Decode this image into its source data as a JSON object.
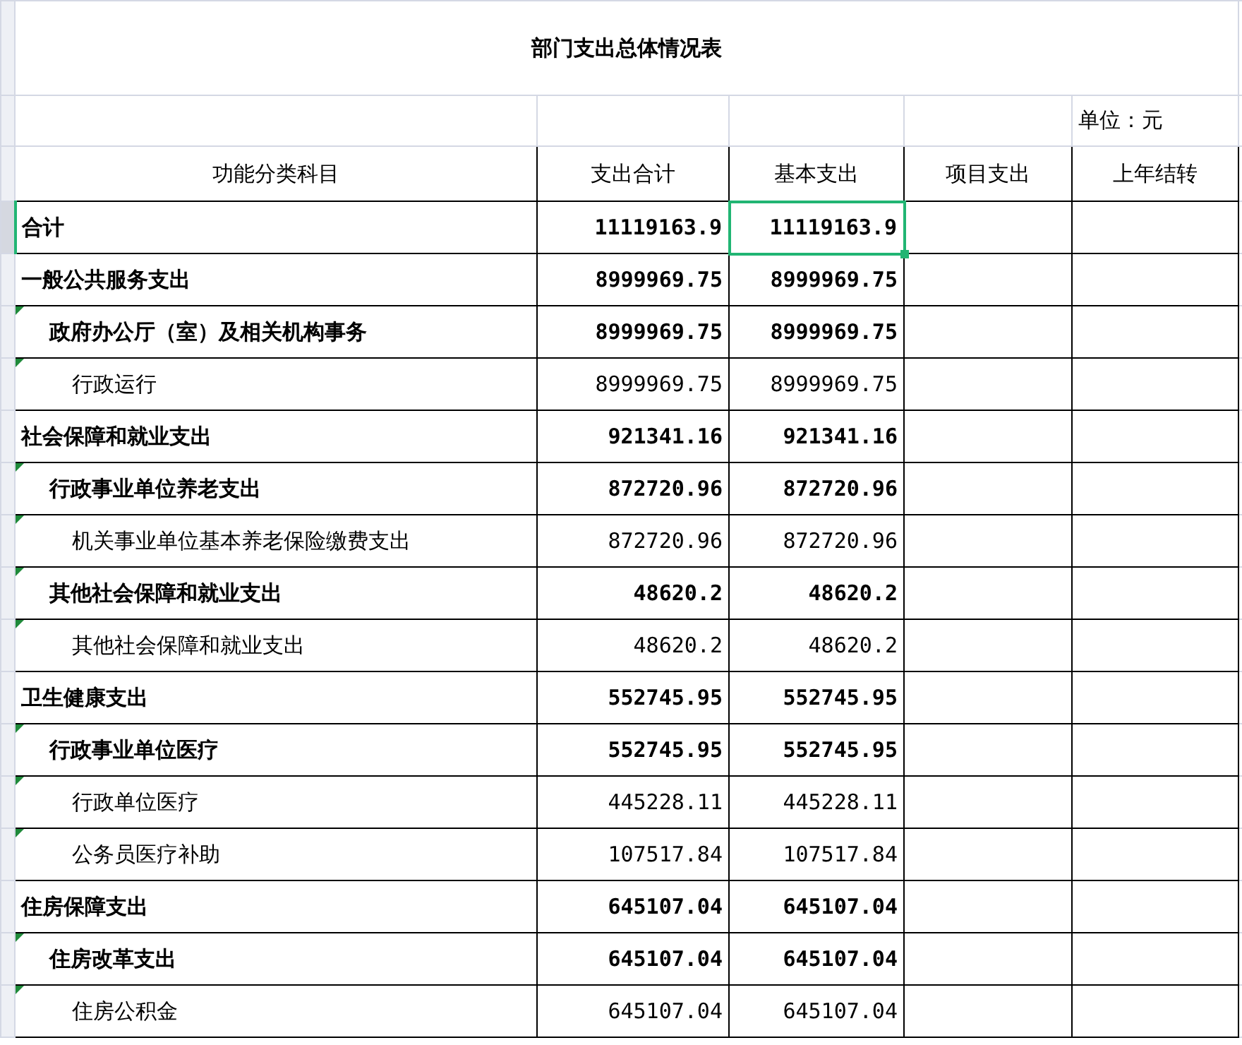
{
  "title": "部门支出总体情况表",
  "unit": "单位：元",
  "columns": [
    "功能分类科目",
    "支出合计",
    "基本支出",
    "项目支出",
    "上年结转"
  ],
  "total": {
    "label": "合计",
    "amounts": [
      {
        "text": "11119163.9",
        "selected": false
      },
      {
        "text": "11119163.9",
        "selected": true
      }
    ]
  },
  "categories": [
    {
      "label": "一般公共服务支出",
      "amounts": [
        {
          "text": "8999969.75",
          "selected": false
        },
        {
          "text": "8999969.75",
          "selected": false
        }
      ],
      "children": [
        {
          "label": "政府办公厅（室）及相关机构事务",
          "amounts": [
            {
              "text": "8999969.75",
              "selected": false
            },
            {
              "text": "8999969.75",
              "selected": false
            }
          ],
          "children": [
            {
              "label": "行政运行",
              "amounts": [
                {
                  "text": "8999969.75",
                  "selected": false
                },
                {
                  "text": "8999969.75",
                  "selected": false
                }
              ]
            }
          ]
        }
      ]
    },
    {
      "label": "社会保障和就业支出",
      "amounts": [
        {
          "text": "921341.16",
          "selected": false
        },
        {
          "text": "921341.16",
          "selected": false
        }
      ],
      "children": [
        {
          "label": "行政事业单位养老支出",
          "amounts": [
            {
              "text": "872720.96",
              "selected": false
            },
            {
              "text": "872720.96",
              "selected": false
            }
          ],
          "children": [
            {
              "label": "机关事业单位基本养老保险缴费支出",
              "amounts": [
                {
                  "text": "872720.96",
                  "selected": false
                },
                {
                  "text": "872720.96",
                  "selected": false
                }
              ]
            }
          ]
        },
        {
          "label": "其他社会保障和就业支出",
          "amounts": [
            {
              "text": "48620.2",
              "selected": false
            },
            {
              "text": "48620.2",
              "selected": false
            }
          ],
          "children": [
            {
              "label": "其他社会保障和就业支出",
              "amounts": [
                {
                  "text": "48620.2",
                  "selected": false
                },
                {
                  "text": "48620.2",
                  "selected": false
                }
              ]
            }
          ]
        }
      ]
    },
    {
      "label": "卫生健康支出",
      "amounts": [
        {
          "text": "552745.95",
          "selected": false
        },
        {
          "text": "552745.95",
          "selected": false
        }
      ],
      "children": [
        {
          "label": "行政事业单位医疗",
          "amounts": [
            {
              "text": "552745.95",
              "selected": false
            },
            {
              "text": "552745.95",
              "selected": false
            }
          ],
          "children": [
            {
              "label": "行政单位医疗",
              "amounts": [
                {
                  "text": "445228.11",
                  "selected": false
                },
                {
                  "text": "445228.11",
                  "selected": false
                }
              ]
            },
            {
              "label": "公务员医疗补助",
              "amounts": [
                {
                  "text": "107517.84",
                  "selected": false
                },
                {
                  "text": "107517.84",
                  "selected": false
                }
              ]
            }
          ]
        }
      ]
    },
    {
      "label": "住房保障支出",
      "amounts": [
        {
          "text": "645107.04",
          "selected": false
        },
        {
          "text": "645107.04",
          "selected": false
        }
      ],
      "children": [
        {
          "label": "住房改革支出",
          "amounts": [
            {
              "text": "645107.04",
              "selected": false
            },
            {
              "text": "645107.04",
              "selected": false
            }
          ],
          "children": [
            {
              "label": "住房公积金",
              "amounts": [
                {
                  "text": "645107.04",
                  "selected": false
                },
                {
                  "text": "645107.04",
                  "selected": false
                }
              ]
            }
          ]
        }
      ]
    }
  ]
}
